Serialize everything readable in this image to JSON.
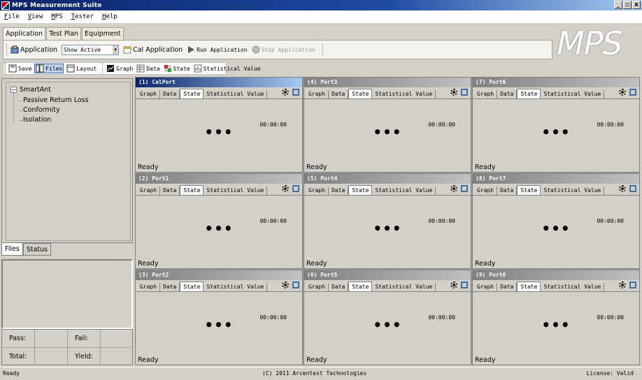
{
  "window": {
    "title": "MPS Measurement Suite",
    "controls": [
      "_",
      "▫",
      "x"
    ]
  },
  "menu": [
    "File",
    "View",
    "MPS",
    "Tester",
    "Help"
  ],
  "ribbon": {
    "tabs": [
      "Application",
      "Test Plan",
      "Equipment"
    ],
    "application_label": "Application",
    "select_value": "Show Active",
    "cal_label": "Cal Application",
    "run_label": "Run Application",
    "stop_label": "Stop Application"
  },
  "logo": "MPS",
  "toolbar": {
    "save": "Save",
    "files": "Files",
    "layout": "Layout",
    "graph": "Graph",
    "data": "Data",
    "state": "State",
    "statistical": "Statistical Value"
  },
  "tree": {
    "root": "SmartAnt",
    "toggle": "−",
    "children": [
      "Passive Return Loss",
      "Conformity",
      "Isolation"
    ]
  },
  "left_tabs": [
    "Files",
    "Status"
  ],
  "stats": {
    "pass_label": "Pass:",
    "fail_label": "Fail:",
    "total_label": "Total:",
    "yield_label": "Yield:"
  },
  "port_tabs": [
    "Graph",
    "Data",
    "State",
    "Statistical Value"
  ],
  "ports": [
    {
      "title": "(1) CalPort",
      "time": "00:00:00",
      "status": "Ready",
      "dots": "•••"
    },
    {
      "title": "(4) Port3",
      "time": "00:00:00",
      "status": "Ready",
      "dots": "•••"
    },
    {
      "title": "(7) Port6",
      "time": "00:00:00",
      "status": "Ready",
      "dots": "•••"
    },
    {
      "title": "(2) Port1",
      "time": "00:00:00",
      "status": "Ready",
      "dots": "•••"
    },
    {
      "title": "(5) Port4",
      "time": "00:00:00",
      "status": "Ready",
      "dots": "•••"
    },
    {
      "title": "(8) Port7",
      "time": "00:00:00",
      "status": "Ready",
      "dots": "•••"
    },
    {
      "title": "(3) Port2",
      "time": "00:00:00",
      "status": "Ready",
      "dots": "•••"
    },
    {
      "title": "(6) Port5",
      "time": "00:00:00",
      "status": "Ready",
      "dots": "•••"
    },
    {
      "title": "(9) Port8",
      "time": "00:00:00",
      "status": "Ready",
      "dots": "•••"
    }
  ],
  "statusbar": {
    "left": "Ready",
    "center": "(C) 2011 Arcentest Technologies",
    "right": "License: Valid"
  }
}
